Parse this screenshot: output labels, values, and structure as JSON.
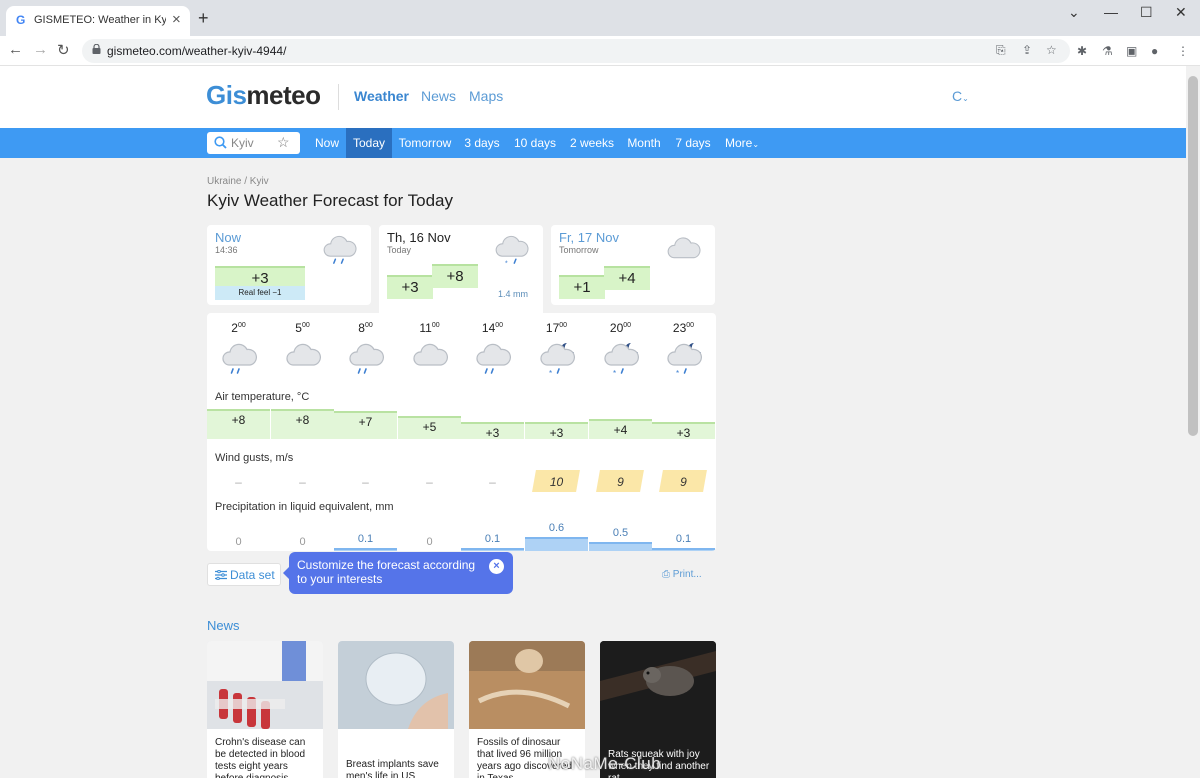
{
  "browser": {
    "tab_title": "GISMETEO: Weather in Kyiv today",
    "tab_favicon": "G",
    "url": "gismeteo.com/weather-kyiv-4944/"
  },
  "site": {
    "logo_part1": "Gis",
    "logo_part2": "meteo",
    "header_links": [
      "Weather",
      "News",
      "Maps"
    ],
    "unit_switch": "C",
    "search_value": "Kyiv",
    "nav": [
      "Now",
      "Today",
      "Tomorrow",
      "3 days",
      "10 days",
      "2 weeks",
      "Month",
      "7 days",
      "More"
    ]
  },
  "breadcrumb": "Ukraine / Kyiv",
  "title": "Kyiv Weather Forecast for Today",
  "cards": {
    "now": {
      "label": "Now",
      "sub": "14:36",
      "temp": "+3",
      "realfeel": "Real feel −1"
    },
    "today": {
      "label": "Th, 16 Nov",
      "sub": "Today",
      "temp_min": "+3",
      "temp_max": "+8",
      "precip": "1.4 mm"
    },
    "tomorrow": {
      "label": "Fr, 17 Nov",
      "sub": "Tomorrow",
      "temp_min": "+1",
      "temp_max": "+4"
    }
  },
  "hourly": {
    "hours": [
      "2",
      "5",
      "8",
      "11",
      "14",
      "17",
      "20",
      "23"
    ],
    "minutes": "00",
    "icons": [
      "cloud-rain-icon",
      "cloud-icon",
      "cloud-rain-icon",
      "cloud-icon",
      "cloud-rain-icon",
      "night-cloud-snow-icon",
      "night-cloud-snow-icon",
      "night-cloud-snow-icon"
    ],
    "air_label": "Air temperature, °C",
    "temps": [
      "+8",
      "+8",
      "+7",
      "+5",
      "+3",
      "+3",
      "+4",
      "+3"
    ],
    "wind_label": "Wind gusts, m/s",
    "gusts": [
      "–",
      "–",
      "–",
      "–",
      "–",
      "10",
      "9",
      "9"
    ],
    "precip_label": "Precipitation in liquid equivalent, mm",
    "precip": [
      "0",
      "0",
      "0.1",
      "0",
      "0.1",
      "0.6",
      "0.5",
      "0.1"
    ]
  },
  "dataset_label": "Data set",
  "tooltip_text": "Customize the forecast according to your interests",
  "print_label": "Print...",
  "news": {
    "heading": "News",
    "items": [
      "Crohn's disease can be detected in blood tests eight years before diagnosis",
      "Breast implants save men's life in US",
      "Fossils of dinosaur that lived 96 million years ago discovered in Texas",
      "Rats squeak with joy when they find another rat"
    ]
  },
  "watermark": "NoNaMe-Club",
  "colors": {
    "accent": "#3e9af3",
    "nav_active": "#2a6fbf",
    "tooltip": "#5574e9"
  }
}
